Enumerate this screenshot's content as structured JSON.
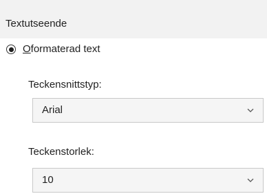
{
  "group": {
    "title": "Textutseende"
  },
  "radio": {
    "label_mnemonic": "O",
    "label_rest": "formaterad text",
    "checked": true
  },
  "font_type": {
    "label": "Teckensnittstyp:",
    "value": "Arial"
  },
  "font_size": {
    "label": "Teckenstorlek:",
    "value": "10"
  },
  "icons": {
    "dropdown": "chevron-down-icon"
  }
}
